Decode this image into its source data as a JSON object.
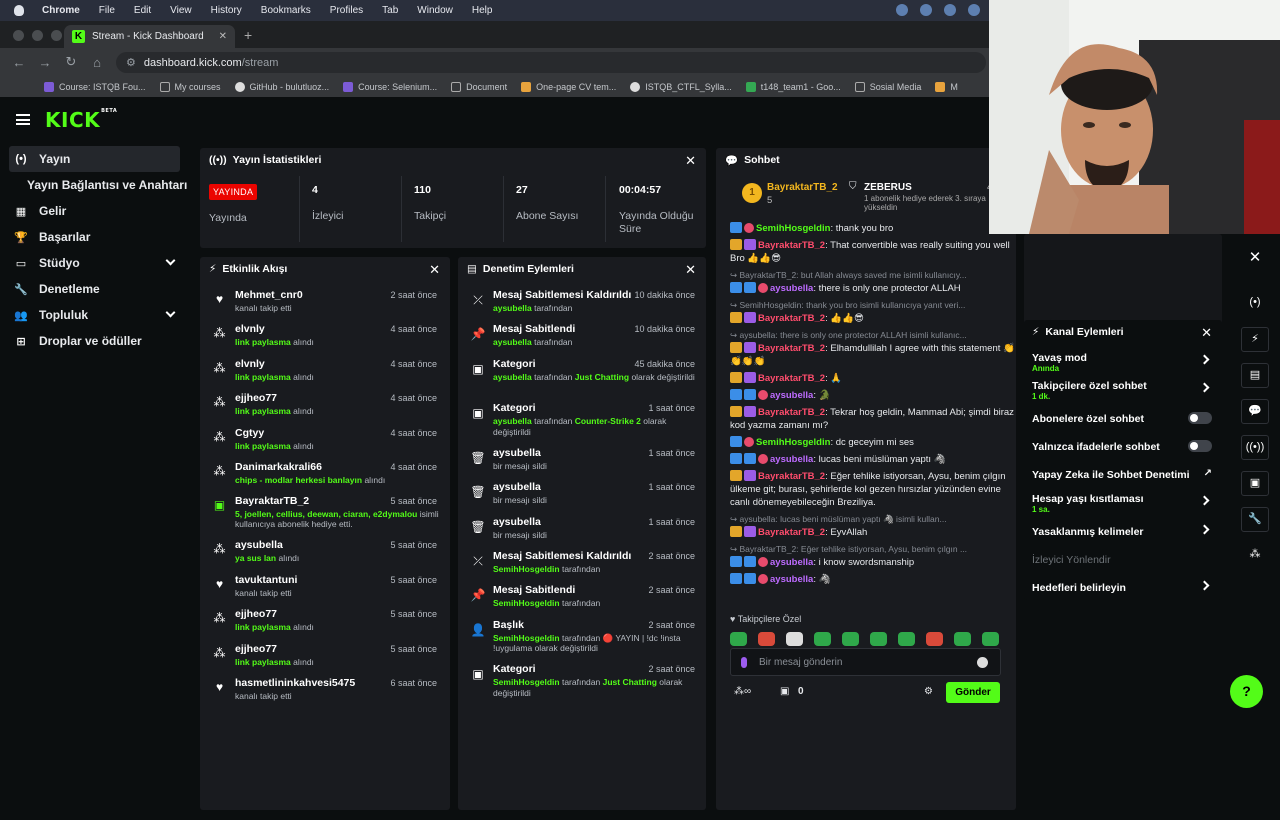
{
  "menubar": {
    "items": [
      "Chrome",
      "File",
      "Edit",
      "View",
      "History",
      "Bookmarks",
      "Profiles",
      "Tab",
      "Window",
      "Help"
    ]
  },
  "browser": {
    "tab_title": "Stream - Kick Dashboard",
    "url_host": "dashboard.kick.com",
    "url_path": "/stream",
    "bookmarks": [
      "Course: ISTQB Fou...",
      "My courses",
      "GitHub - bulutluoz...",
      "Course: Selenium...",
      "Document",
      "One-page CV tem...",
      "ISTQB_CTFL_Sylla...",
      "t148_team1 - Goo...",
      "Sosial Media",
      "M"
    ]
  },
  "logo": {
    "text": "KICK",
    "badge": "BETA"
  },
  "sidebar": {
    "items": [
      {
        "label": "Yayın"
      },
      {
        "label": "Yayın Bağlantısı ve Anahtarı"
      },
      {
        "label": "Gelir"
      },
      {
        "label": "Başarılar"
      },
      {
        "label": "Stüdyo"
      },
      {
        "label": "Denetleme"
      },
      {
        "label": "Topluluk"
      },
      {
        "label": "Droplar ve ödüller"
      }
    ]
  },
  "stats": {
    "title": "Yayın İstatistikleri",
    "live_badge": "YAYINDA",
    "live_label": "Yayında",
    "items": [
      {
        "value": "4",
        "label": "İzleyici"
      },
      {
        "value": "110",
        "label": "Takipçi"
      },
      {
        "value": "27",
        "label": "Abone Sayısı"
      },
      {
        "value": "00:04:57",
        "label": "Yayında Olduğu Süre"
      }
    ]
  },
  "activity": {
    "title": "Etkinlik Akışı",
    "rows": [
      {
        "name": "Mehmet_cnr0",
        "time": "2 saat önce",
        "hl": "",
        "desc": "kanalı takip etti"
      },
      {
        "name": "elvnly",
        "time": "4 saat önce",
        "hl": "link paylasma",
        "desc": " alındı"
      },
      {
        "name": "elvnly",
        "time": "4 saat önce",
        "hl": "link paylasma",
        "desc": " alındı"
      },
      {
        "name": "ejjheo77",
        "time": "4 saat önce",
        "hl": "link paylasma",
        "desc": " alındı"
      },
      {
        "name": "Cgtyy",
        "time": "4 saat önce",
        "hl": "link paylasma",
        "desc": " alındı"
      },
      {
        "name": "Danimarkakrali66",
        "time": "4 saat önce",
        "hl": "chips - modlar herkesi banlayın",
        "desc": " alındı"
      },
      {
        "name": "BayraktarTB_2",
        "time": "5 saat önce",
        "hl": "5, joellen, cellius, deewan, ciaran, e2dymalou",
        "desc": " isimli kullanıcıya abonelik hediye etti."
      },
      {
        "name": "aysubella",
        "time": "5 saat önce",
        "hl": "ya sus lan",
        "desc": " alındı"
      },
      {
        "name": "tavuktantuni",
        "time": "5 saat önce",
        "hl": "",
        "desc": "kanalı takip etti"
      },
      {
        "name": "ejjheo77",
        "time": "5 saat önce",
        "hl": "link paylasma",
        "desc": " alındı"
      },
      {
        "name": "ejjheo77",
        "time": "5 saat önce",
        "hl": "link paylasma",
        "desc": " alındı"
      },
      {
        "name": "hasmetlininkahvesi5475",
        "time": "6 saat önce",
        "hl": "",
        "desc": "kanalı takip etti"
      }
    ]
  },
  "moderation": {
    "title": "Denetim Eylemleri",
    "rows": [
      {
        "name": "Mesaj Sabitlemesi Kaldırıldı",
        "time": "10 dakika önce",
        "hl": "aysubella",
        "desc": " tarafından",
        "hl2": "",
        "desc2": ""
      },
      {
        "name": "Mesaj Sabitlendi",
        "time": "10 dakika önce",
        "hl": "aysubella",
        "desc": " tarafından",
        "hl2": "",
        "desc2": ""
      },
      {
        "name": "Kategori",
        "time": "45 dakika önce",
        "hl": "aysubella",
        "desc": " tarafından ",
        "hl2": "Just Chatting",
        "desc2": " olarak değiştirildi"
      },
      {
        "name": "Kategori",
        "time": "1 saat önce",
        "hl": "aysubella",
        "desc": " tarafından ",
        "hl2": "Counter-Strike 2",
        "desc2": " olarak değiştirildi"
      },
      {
        "name": "aysubella",
        "time": "1 saat önce",
        "hl": "",
        "desc": "bir mesajı sildi",
        "hl2": "",
        "desc2": ""
      },
      {
        "name": "aysubella",
        "time": "1 saat önce",
        "hl": "",
        "desc": "bir mesajı sildi",
        "hl2": "",
        "desc2": ""
      },
      {
        "name": "aysubella",
        "time": "1 saat önce",
        "hl": "",
        "desc": "bir mesajı sildi",
        "hl2": "",
        "desc2": ""
      },
      {
        "name": "Mesaj Sabitlemesi Kaldırıldı",
        "time": "2 saat önce",
        "hl": "SemihHosgeldin",
        "desc": " tarafından",
        "hl2": "",
        "desc2": ""
      },
      {
        "name": "Mesaj Sabitlendi",
        "time": "2 saat önce",
        "hl": "SemihHosgeldin",
        "desc": " tarafından",
        "hl2": "",
        "desc2": ""
      },
      {
        "name": "Başlık",
        "time": "2 saat önce",
        "hl": "SemihHosgeldin",
        "desc": " tarafından 🔴 YAYIN | !dc !insta !uygulama olarak değiştirildi",
        "hl2": "",
        "desc2": ""
      },
      {
        "name": "Kategori",
        "time": "2 saat önce",
        "hl": "SemihHosgeldin",
        "desc": " tarafından ",
        "hl2": "Just Chatting",
        "desc2": " olarak değiştirildi"
      }
    ]
  },
  "chat": {
    "title": "Sohbet",
    "top1_name": "BayraktarTB_2",
    "top1_count": "5",
    "top2_name": "ZEBERUS",
    "top2_count": "4",
    "top2_desc": "1 abonelik hediye ederek 3. sıraya yükseldin",
    "messages": [
      {
        "type": "msg",
        "user": "SemihHosgeldin",
        "ucolor": "green",
        "text": ": thank you bro"
      },
      {
        "type": "msg",
        "user": "BayraktarTB_2",
        "ucolor": "red",
        "text": ": That convertible was really suiting you well Bro 👍👍😎"
      },
      {
        "type": "reply",
        "text": "↪ BayraktarTB_2: but Allah always saved me isimli kullanıcıy..."
      },
      {
        "type": "msg",
        "user": "aysubella",
        "ucolor": "pur",
        "text": ": there is only one protector ALLAH"
      },
      {
        "type": "reply",
        "text": "↪ SemihHosgeldin: thank you bro isimli kullanıcıya yanıt veri..."
      },
      {
        "type": "msg",
        "user": "BayraktarTB_2",
        "ucolor": "red",
        "text": ": 👍👍😎"
      },
      {
        "type": "reply",
        "text": "↪ aysubella: there is only one protector ALLAH isimli kullanıc..."
      },
      {
        "type": "msg",
        "user": "BayraktarTB_2",
        "ucolor": "red",
        "text": ": Elhamdullilah I agree with this statement 👏👏👏👏"
      },
      {
        "type": "msg",
        "user": "BayraktarTB_2",
        "ucolor": "red",
        "text": ": 🙏"
      },
      {
        "type": "msg",
        "user": "aysubella",
        "ucolor": "pur",
        "text": ": 🐊"
      },
      {
        "type": "msg",
        "user": "BayraktarTB_2",
        "ucolor": "red",
        "text": ": Tekrar hoş geldin, Mammad Abi; şimdi biraz kod yazma zamanı mı?"
      },
      {
        "type": "msg",
        "user": "SemihHosgeldin",
        "ucolor": "green",
        "text": ": dc geceyim mi ses"
      },
      {
        "type": "msg",
        "user": "aysubella",
        "ucolor": "pur",
        "text": ": lucas beni müslüman yaptı 🦓"
      },
      {
        "type": "msg",
        "user": "BayraktarTB_2",
        "ucolor": "red",
        "text": ": Eğer tehlike istiyorsan, Aysu, benim çılgın ülkeme git; burası, şehirlerde kol gezen hırsızlar yüzünden evine canlı dönemeyebileceğin Breziliya."
      },
      {
        "type": "reply",
        "text": "↪ aysubella: lucas beni müslüman yaptı 🦓 isimli kullan..."
      },
      {
        "type": "msg",
        "user": "BayraktarTB_2",
        "ucolor": "red",
        "text": ": EyvAllah"
      },
      {
        "type": "reply",
        "text": "↪ BayraktarTB_2: Eğer tehlike istiyorsan, Aysu, benim çılgın ..."
      },
      {
        "type": "msg",
        "user": "aysubella",
        "ucolor": "pur",
        "text": ": i know swordsmanship"
      },
      {
        "type": "msg",
        "user": "aysubella",
        "ucolor": "pur",
        "text": ": 🦓"
      }
    ],
    "emote_label": "Takipçilere Özel",
    "input_placeholder": "Bir mesaj gönderin",
    "points": "0",
    "send_label": "Gönder"
  },
  "channel_actions": {
    "title": "Kanal Eylemleri",
    "rows": [
      {
        "label": "Yavaş mod",
        "sub": "Anında",
        "ctrl": "arrow"
      },
      {
        "label": "Takipçilere özel sohbet",
        "sub": "1 dk.",
        "ctrl": "arrow"
      },
      {
        "label": "Abonelere özel sohbet",
        "sub": "",
        "ctrl": "toggle"
      },
      {
        "label": "Yalnızca ifadelerle sohbet",
        "sub": "",
        "ctrl": "toggle"
      },
      {
        "label": "Yapay Zeka ile Sohbet Denetimi",
        "sub": "",
        "ctrl": "ext"
      },
      {
        "label": "Hesap yaşı kısıtlaması",
        "sub": "1 sa.",
        "ctrl": "arrow"
      },
      {
        "label": "Yasaklanmış kelimeler",
        "sub": "",
        "ctrl": "arrow"
      },
      {
        "label": "İzleyici Yönlendir",
        "sub": "",
        "ctrl": "dim"
      },
      {
        "label": "Hedefleri belirleyin",
        "sub": "",
        "ctrl": "arrow"
      }
    ]
  },
  "colors": {
    "accent": "#53fc18",
    "live": "#eb0400",
    "panel": "#191b1f",
    "bg": "#0b0e0f"
  }
}
